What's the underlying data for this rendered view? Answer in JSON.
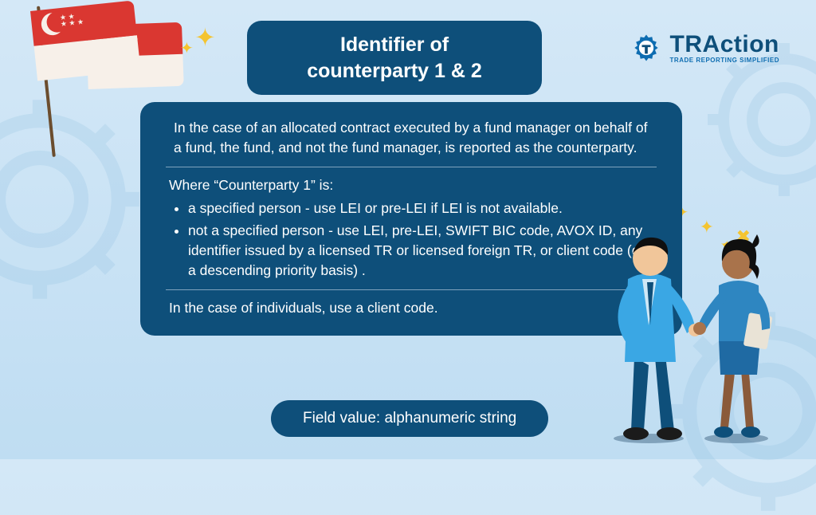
{
  "title_line1": "Identifier of",
  "title_line2": "counterparty 1 & 2",
  "logo": {
    "name": "TRAction",
    "tagline": "TRADE REPORTING SIMPLIFIED"
  },
  "content": {
    "intro": "In the case of an allocated contract executed by a fund manager on behalf of a fund, the fund, and not the fund manager, is reported as the counterparty.",
    "where_line": "Where “Counterparty 1” is:",
    "bullet1": "a specified person - use LEI or pre-LEI if LEI is not available.",
    "bullet2": "not a specified person - use LEI, pre-LEI, SWIFT BIC code, AVOX ID, any identifier issued by a licensed TR or licensed foreign TR, or client code (on a descending priority basis) .",
    "individuals": "In the case of individuals, use a client code."
  },
  "footer": "Field value: alphanumeric string"
}
